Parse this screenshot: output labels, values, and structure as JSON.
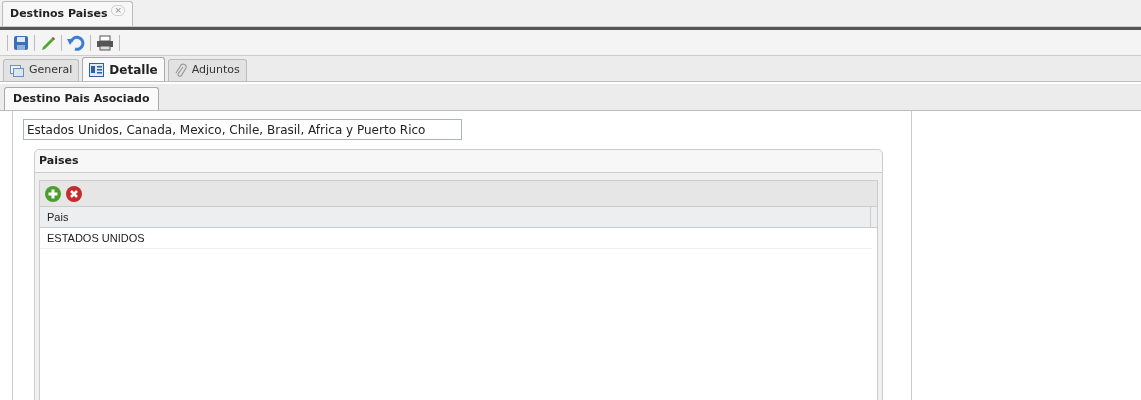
{
  "document_tab": {
    "title": "Destinos Paises",
    "close": "×"
  },
  "toolbar": [
    {
      "kind": "save"
    },
    {
      "kind": "edit"
    },
    {
      "kind": "undo"
    },
    {
      "kind": "print"
    }
  ],
  "tabs": [
    {
      "label": "General",
      "kind": "general",
      "selected": false
    },
    {
      "label": "Detalle",
      "kind": "detail",
      "selected": true
    },
    {
      "label": "Adjuntos",
      "kind": "attach",
      "selected": false
    }
  ],
  "subtabs": [
    {
      "label": "Destino Pais Asociado",
      "selected": true
    }
  ],
  "description": {
    "value": "Estados Unidos, Canada, Mexico, Chile, Brasil, Africa y Puerto Rico"
  },
  "panel": {
    "title": "Paises",
    "grid_toolbar": [
      {
        "kind": "add"
      },
      {
        "kind": "delete"
      }
    ],
    "columns": [
      "Pais"
    ],
    "rows": [
      [
        "ESTADOS UNIDOS"
      ]
    ]
  }
}
